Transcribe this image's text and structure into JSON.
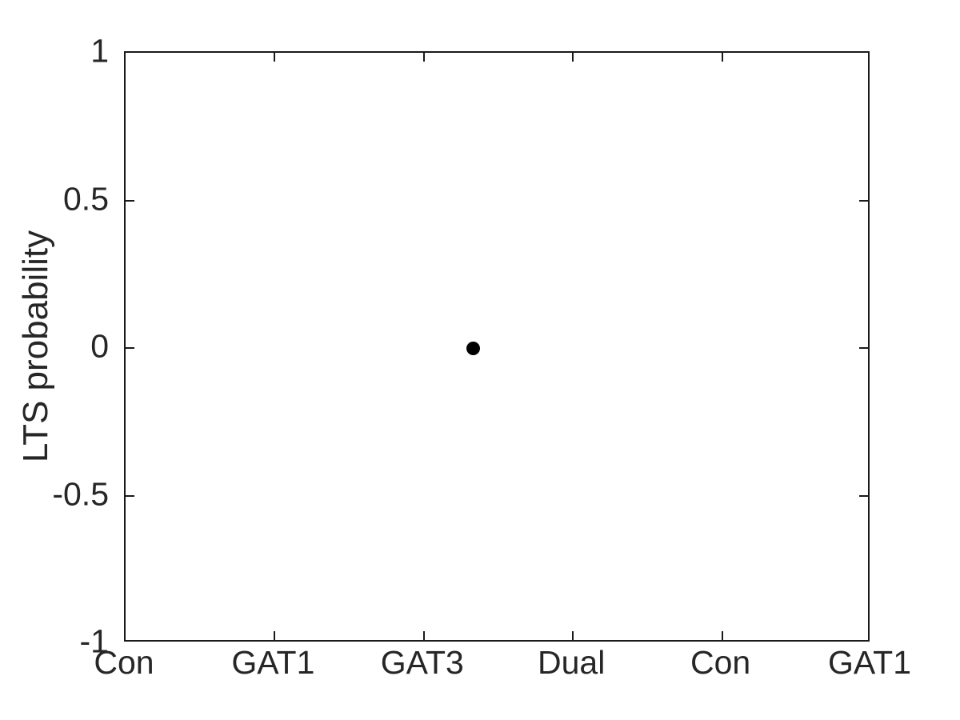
{
  "figure": {
    "background_color": "#ffffff",
    "axis_color": "#1a1a1a",
    "text_color": "#262626",
    "marker_color": "#000000"
  },
  "chart_data": {
    "type": "scatter",
    "title": "",
    "xlabel": "",
    "ylabel": "LTS probability",
    "categories": [
      "Con",
      "GAT1",
      "GAT3",
      "Dual",
      "Con",
      "GAT1"
    ],
    "xtick_labels": [
      "Con",
      "GAT1",
      "GAT3",
      "Dual",
      "Con",
      "GAT1"
    ],
    "xtick_positions": [
      1,
      2,
      3,
      4,
      5,
      6
    ],
    "xlim": [
      1,
      6
    ],
    "ylim": [
      -1,
      1
    ],
    "ytick_values": [
      1,
      0.5,
      0,
      -0.5,
      -1
    ],
    "ytick_labels": [
      "1",
      "0.5",
      "0",
      "-0.5",
      "-1"
    ],
    "grid": false,
    "legend": null,
    "box": true,
    "points": [
      {
        "x": 3.33,
        "y": 0,
        "label": ""
      }
    ],
    "series": [
      {
        "name": "LTS probability",
        "marker": "filled-circle",
        "color": "#000000",
        "x": [
          3.33
        ],
        "values": [
          0
        ]
      }
    ]
  }
}
